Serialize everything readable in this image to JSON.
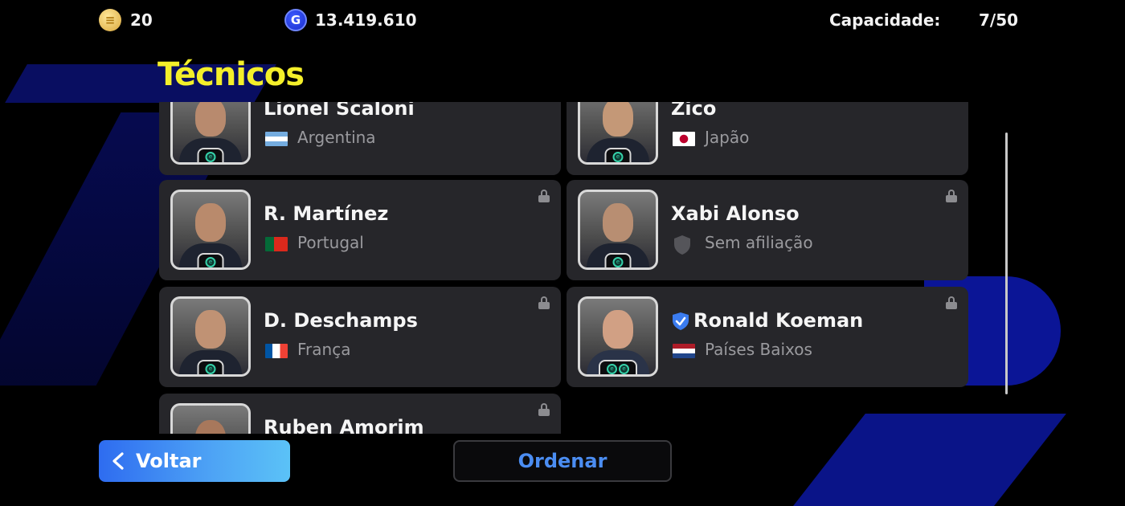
{
  "header": {
    "ecoin_icon": "ecoin-icon",
    "ecoins": "20",
    "gp_icon": "gp-icon",
    "gp": "13.419.610",
    "capacity_label": "Capacidade:",
    "capacity_value": "7/50"
  },
  "page_title": "Técnicos",
  "managers": [
    {
      "name": "Lionel Scaloni",
      "country": "Argentina",
      "locked": false,
      "verified": false,
      "badges": 1
    },
    {
      "name": "Zico",
      "country": "Japão",
      "locked": false,
      "verified": false,
      "badges": 1
    },
    {
      "name": "R. Martínez",
      "country": "Portugal",
      "locked": true,
      "verified": false,
      "badges": 1
    },
    {
      "name": "Xabi Alonso",
      "country": "Sem afiliação",
      "locked": true,
      "verified": false,
      "badges": 1
    },
    {
      "name": "D. Deschamps",
      "country": "França",
      "locked": true,
      "verified": false,
      "badges": 1
    },
    {
      "name": "Ronald Koeman",
      "country": "Países Baixos",
      "locked": true,
      "verified": true,
      "badges": 2
    },
    {
      "name": "Ruben Amorim",
      "country": "",
      "locked": true,
      "verified": false,
      "badges": 1
    }
  ],
  "buttons": {
    "back_label": "Voltar",
    "sort_label": "Ordenar"
  },
  "colors": {
    "title": "#f4ef2a",
    "accent_blue": "#4b8df2",
    "card": "#26262a"
  }
}
